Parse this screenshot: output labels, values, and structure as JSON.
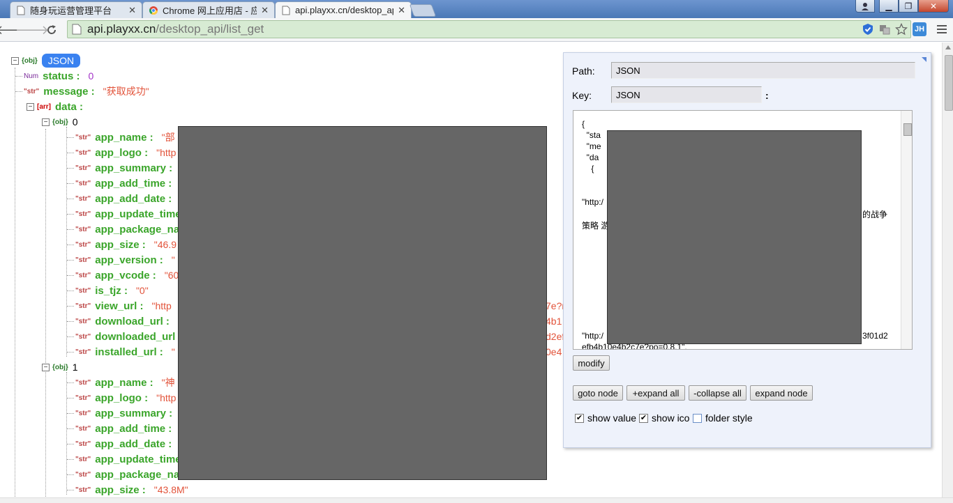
{
  "browser": {
    "tabs": [
      {
        "title": "随身玩运营管理平台",
        "close": "✕"
      },
      {
        "title": "Chrome 网上应用店 - 应用",
        "close": "✕"
      },
      {
        "title": "api.playxx.cn/desktop_api/list_get",
        "close": "✕"
      }
    ],
    "window_buttons": {
      "minimize": "▁",
      "maximize": "❐",
      "close": "✕"
    },
    "url_host": "api.playxx.cn",
    "url_path": "/desktop_api/list_get",
    "extension_badge": "JH"
  },
  "tree": {
    "root_tag": "{obj}",
    "root_label": "JSON",
    "status": {
      "tag": "Num",
      "key": "status :",
      "value": "0"
    },
    "message": {
      "tag": "\"str\"",
      "key": "message :",
      "value": "\"获取成功\""
    },
    "data": {
      "tag": "[arr]",
      "key": "data :"
    },
    "item0": {
      "tag": "{obj}",
      "index": "0",
      "fields": [
        {
          "tag": "\"str\"",
          "key": "app_name :",
          "value": "\"部"
        },
        {
          "tag": "\"str\"",
          "key": "app_logo :",
          "value": "\"http"
        },
        {
          "tag": "\"str\"",
          "key": "app_summary :",
          "value": ""
        },
        {
          "tag": "\"str\"",
          "key": "app_add_time :",
          "value": ""
        },
        {
          "tag": "\"str\"",
          "key": "app_add_date :",
          "value": ""
        },
        {
          "tag": "\"str\"",
          "key": "app_update_time",
          "value": ""
        },
        {
          "tag": "\"str\"",
          "key": "app_package_na",
          "value": ""
        },
        {
          "tag": "\"str\"",
          "key": "app_size :",
          "value": "\"46.9"
        },
        {
          "tag": "\"str\"",
          "key": "app_version :",
          "value": "\""
        },
        {
          "tag": "\"str\"",
          "key": "app_vcode :",
          "value": "\"60"
        },
        {
          "tag": "\"str\"",
          "key": "is_tjz :",
          "value": "\"0\""
        },
        {
          "tag": "\"str\"",
          "key": "view_url :",
          "value": "\"http",
          "tail": "7e?r"
        },
        {
          "tag": "\"str\"",
          "key": "download_url :",
          "value": "",
          "tail": "4b1"
        },
        {
          "tag": "\"str\"",
          "key": "downloaded_url",
          "value": "",
          "tail": "d2ef"
        },
        {
          "tag": "\"str\"",
          "key": "installed_url :",
          "value": "\"",
          "tail": "0e4"
        }
      ]
    },
    "item1": {
      "tag": "{obj}",
      "index": "1",
      "fields": [
        {
          "tag": "\"str\"",
          "key": "app_name :",
          "value": "\"神"
        },
        {
          "tag": "\"str\"",
          "key": "app_logo :",
          "value": "\"http"
        },
        {
          "tag": "\"str\"",
          "key": "app_summary :",
          "value": ""
        },
        {
          "tag": "\"str\"",
          "key": "app_add_time :",
          "value": ""
        },
        {
          "tag": "\"str\"",
          "key": "app_add_date :",
          "value": ""
        },
        {
          "tag": "\"str\"",
          "key": "app_update_time",
          "value": ""
        },
        {
          "tag": "\"str\"",
          "key": "app_package_na",
          "value": ""
        },
        {
          "tag": "\"str\"",
          "key": "app_size :",
          "value": "\"43.8M\""
        }
      ]
    }
  },
  "panel": {
    "path_label": "Path:",
    "path_value": "JSON",
    "key_label": "Key:",
    "key_value": "JSON",
    "key_colon": ":",
    "text_lines": [
      "{",
      "  \"sta",
      "  \"me",
      "  \"da",
      "    {",
      "\"http:/",
      "的战争",
      "策略 游",
      "\"http:/",
      "3f01d2",
      "efb4b10e4b2c7e?po=0.8.1\","
    ],
    "modify_label": "modify",
    "buttons": {
      "goto": "goto node",
      "expand_all": "+expand all",
      "collapse_all": "-collapse all",
      "expand_node": "expand node"
    },
    "checks": [
      {
        "label": "show value",
        "checked": "✔"
      },
      {
        "label": "show ico",
        "checked": "✔"
      },
      {
        "label": "folder style",
        "checked": ""
      }
    ]
  },
  "colors": {
    "key": "#3aa52a",
    "string": "#e2533a",
    "number": "#a333c8",
    "accent": "#3a82f0"
  }
}
